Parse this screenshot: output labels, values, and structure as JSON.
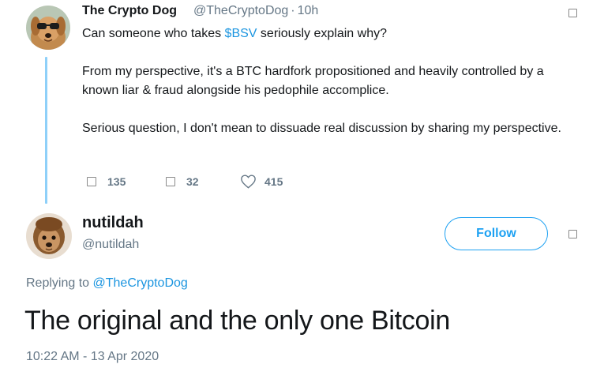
{
  "parent_tweet": {
    "name": "The Crypto Dog",
    "handle": "@TheCryptoDog",
    "separator": "·",
    "time": "10h",
    "text_line1_prefix": "Can someone who takes ",
    "cashtag": "$BSV",
    "text_line1_suffix": " seriously explain why?",
    "paragraph2": "From my perspective, it's a BTC hardfork propositioned and heavily controlled by a known liar & fraud alongside his pedophile accomplice.",
    "paragraph3": "Serious question, I don't mean to dissuade real discussion by sharing my perspective.",
    "actions": {
      "replies": "135",
      "retweets": "32",
      "likes": "415"
    }
  },
  "reply_tweet": {
    "name": "nutildah",
    "handle": "@nutildah",
    "follow_label": "Follow",
    "replying_prefix": "Replying to ",
    "replying_to": "@TheCryptoDog",
    "text": "The original and the only one Bitcoin",
    "timestamp": "10:22 AM - 13 Apr 2020"
  },
  "colors": {
    "link": "#1b95e0",
    "follow_accent": "#1da1f2",
    "thread_line": "#8ed0f9",
    "secondary_text": "#657786"
  },
  "icons": {
    "reply": "reply-icon",
    "retweet": "retweet-icon",
    "like": "heart-icon",
    "more": "chevron-down-icon"
  }
}
